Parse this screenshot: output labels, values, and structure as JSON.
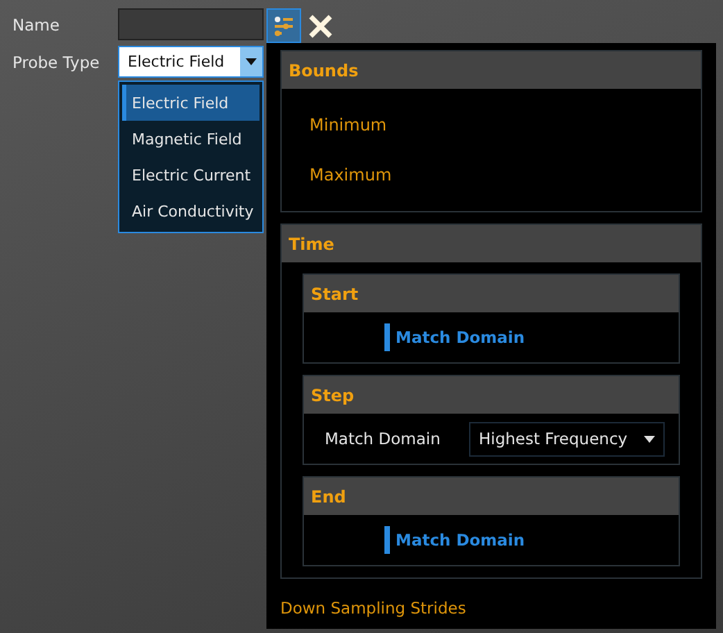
{
  "form": {
    "name_label": "Name",
    "probe_type_label": "Probe Type",
    "probe_type_value": "Electric Field",
    "dropdown_open": true,
    "options": [
      {
        "label": "Electric Field",
        "selected": true
      },
      {
        "label": "Magnetic Field",
        "selected": false
      },
      {
        "label": "Electric Current",
        "selected": false
      },
      {
        "label": "Air Conductivity",
        "selected": false
      }
    ]
  },
  "bounds": {
    "title": "Bounds",
    "items": [
      "Minimum",
      "Maximum"
    ]
  },
  "time": {
    "title": "Time",
    "sections": [
      {
        "title": "Start",
        "kind": "link",
        "text": "Match Domain"
      },
      {
        "title": "Step",
        "kind": "select",
        "label": "Match Domain",
        "value": "Highest Frequency"
      },
      {
        "title": "End",
        "kind": "link",
        "text": "Match Domain"
      }
    ]
  },
  "footer": "Down Sampling Strides"
}
